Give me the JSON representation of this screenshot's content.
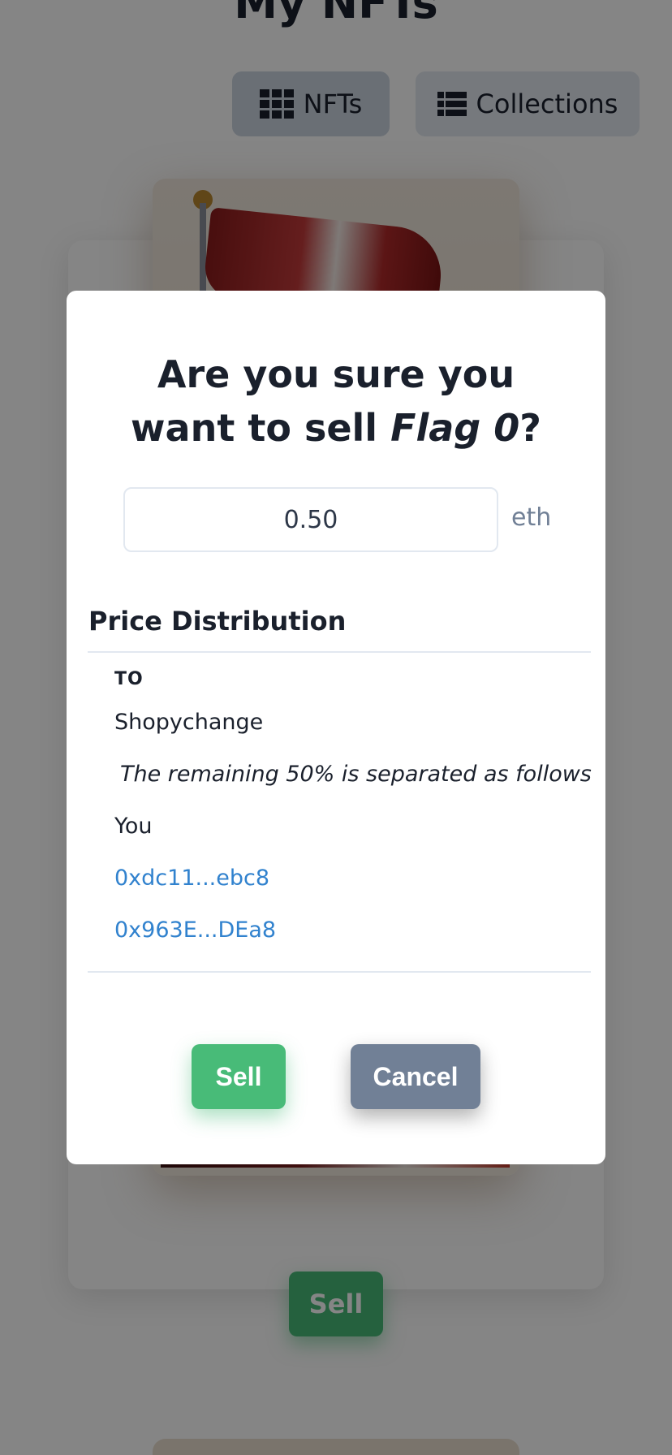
{
  "page": {
    "title": "My NFTs",
    "tabs": {
      "nfts_label": "NFTs",
      "collections_label": "Collections",
      "nfts_icon": "grid-icon",
      "collections_icon": "list-icon"
    },
    "card": {
      "sell_label": "Sell"
    }
  },
  "modal": {
    "title_prefix": "Are you sure you want to sell ",
    "title_item": "Flag 0",
    "title_suffix": "?",
    "price_value": "0.50",
    "price_unit": "eth",
    "distribution": {
      "title": "Price Distribution",
      "column_header": "TO",
      "rows": [
        "Shopychange",
        "You",
        "0xdc11...ebc8",
        "0x963E...DEa8"
      ],
      "note": "The remaining 50% is separated as follows"
    },
    "sell_label": "Sell",
    "cancel_label": "Cancel"
  },
  "colors": {
    "sell": "#48bb78",
    "cancel": "#718096",
    "link": "#3182ce",
    "tab_active": "#cbd5e0"
  }
}
